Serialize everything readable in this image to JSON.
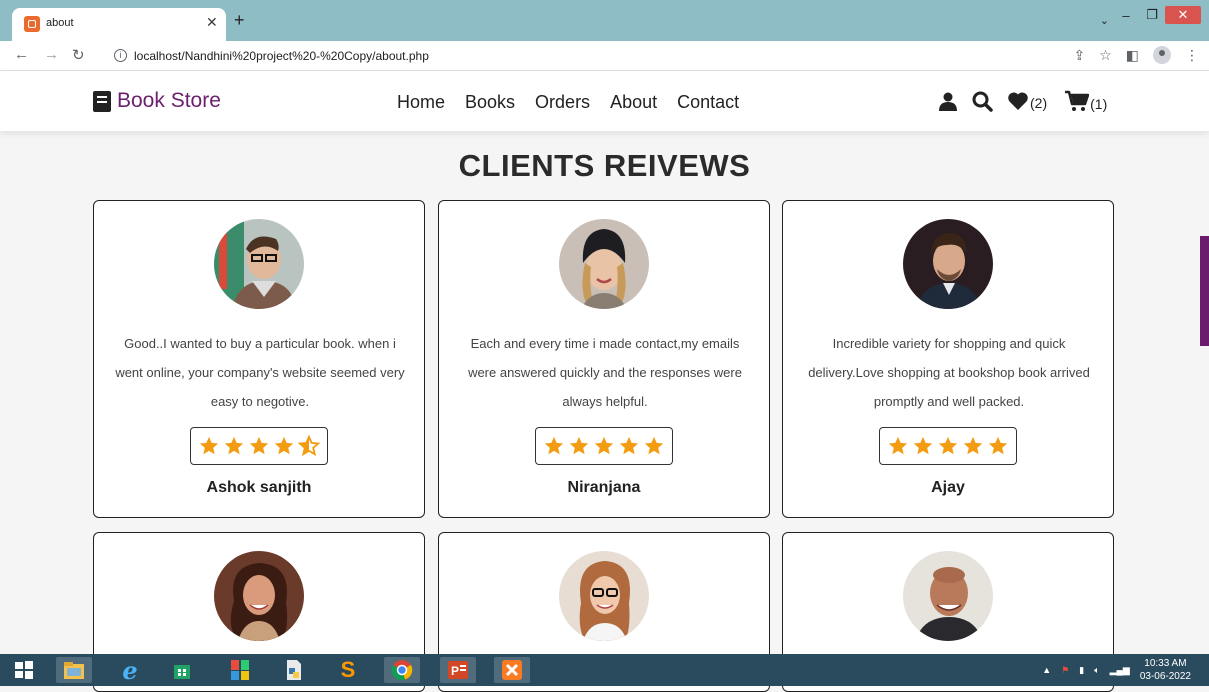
{
  "browser": {
    "tab_title": "about",
    "url": "localhost/Nandhini%20project%20-%20Copy/about.php"
  },
  "site": {
    "logo": "Book Store",
    "nav": [
      "Home",
      "Books",
      "Orders",
      "About",
      "Contact"
    ],
    "wishlist_count": "(2)",
    "cart_count": "(1)",
    "brand_color": "#6b1f6e"
  },
  "section": {
    "heading": "CLIENTS REIVEWS"
  },
  "reviews": [
    {
      "text": "Good..I wanted to buy a particular book. when i went online, your company's website seemed very easy to negotive.",
      "rating": 4.5,
      "name": "Ashok sanjith"
    },
    {
      "text": "Each and every time i made contact,my emails were answered quickly and the responses were always helpful.",
      "rating": 5,
      "name": "Niranjana"
    },
    {
      "text": "Incredible variety for shopping and quick delivery.Love shopping at bookshop book arrived promptly and well packed.",
      "rating": 5,
      "name": "Ajay"
    }
  ],
  "star_color": "#f39c12",
  "taskbar": {
    "time": "10:33 AM",
    "date": "03-06-2022"
  }
}
